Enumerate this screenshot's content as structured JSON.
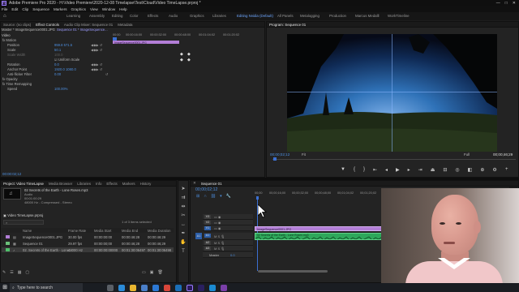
{
  "window": {
    "title": "Adobe Premiere Pro 2020 - H:\\Video Premiere\\2020-12-08 Timelapse\\Test\\Cloud\\Video TimeLapse.prproj *",
    "logo_text": "Pr",
    "controls": [
      "—",
      "□",
      "✕"
    ]
  },
  "menu": [
    "File",
    "Edit",
    "Clip",
    "Sequence",
    "Markers",
    "Graphics",
    "View",
    "Window",
    "Help"
  ],
  "workspaces": {
    "home_icon": "home-icon",
    "tabs": [
      "Learning",
      "Assembly",
      "Editing",
      "Color",
      "Effects",
      "Audio",
      "Graphics",
      "Libraries",
      "Editing Nvidia (Default)",
      "All Panels",
      "Metalogging",
      "Production",
      "Marcus Medalll",
      "WorkTimeline"
    ],
    "active": "Editing Nvidia (Default)"
  },
  "source_panel": {
    "tabs": [
      "Source: (no clips)",
      "Effect Controls",
      "Audio Clip Mixer: Sequence 01",
      "Metadata"
    ],
    "active_tab": "Effect Controls",
    "master_label": "Master * ImageSequence0001.JPG",
    "sequence_label": "Sequence 01 * ImageSequence...",
    "section_video": "Video",
    "clip_name": "ImageSequence0001.JPG",
    "rows": [
      {
        "label": "fx  Motion",
        "value": "",
        "indent": 0
      },
      {
        "label": "Position",
        "value": "959.8     571.5",
        "indent": 1
      },
      {
        "label": "Scale",
        "value": "50.1",
        "indent": 1
      },
      {
        "label": "Scale Width",
        "value": "100.0",
        "indent": 1
      },
      {
        "label": "",
        "value": "Uniform Scale",
        "indent": 2
      },
      {
        "label": "Rotation",
        "value": "0.0",
        "indent": 1
      },
      {
        "label": "Anchor Point",
        "value": "1920.0   1080.0",
        "indent": 1
      },
      {
        "label": "Anti-flicker Filter",
        "value": "0.00",
        "indent": 1
      },
      {
        "label": "fx  Opacity",
        "value": "",
        "indent": 0
      },
      {
        "label": "fx  Time Remapping",
        "value": "",
        "indent": 0
      },
      {
        "label": "Speed",
        "value": "100.00%",
        "indent": 1
      }
    ],
    "timecode": "00:00:02;12",
    "ruler": [
      "00:00",
      "00:00:16:00",
      "00:00:32:00",
      "00:00:48:00",
      "00:01:04:02",
      "00:01:20:02"
    ]
  },
  "program_monitor": {
    "title": "Program: Sequence 01",
    "timecode_left": "00;00;02;12",
    "fit": "Fit",
    "quality": "Full",
    "timecode_right": "00;00;46;29",
    "buttons": [
      "marker-icon",
      "in-point-icon",
      "out-point-icon",
      "go-to-in-icon",
      "step-back-icon",
      "play-icon",
      "step-forward-icon",
      "go-to-out-icon",
      "lift-icon",
      "extract-icon",
      "export-frame-icon",
      "comparison-icon",
      "vr-icon",
      "settings-icon"
    ],
    "colors": {
      "sky_top": "#0a0f1f",
      "sky_mid": "#1f5a93",
      "horizon": "#5c8fc8",
      "ground": "#1c2614"
    }
  },
  "project_panel": {
    "tabs": [
      "Project: Video TimeLapse",
      "Media Browser",
      "Libraries",
      "Info",
      "Effects",
      "Markers",
      "History"
    ],
    "active_tab": "Project: Video TimeLapse",
    "thumb_label": "Video TimeLapse.prproj",
    "clip_info_name": "02 Secrets of the Earth - Lone Rosen.mp3",
    "clip_info_line1": "Audio",
    "clip_info_line2": "00:01:00:29",
    "clip_info_line3": "48000 Hz - Compressed - Stereo",
    "project_file": "Video TimeLapse.prproj",
    "selection_info": "1 of 3 items selected",
    "columns": [
      "Name",
      "Frame Rate",
      "Media Start",
      "Media End",
      "Media Duration"
    ],
    "items": [
      {
        "name": "ImageSequence0001.JPG",
        "fps": "30.00 fps",
        "start": "00:00:00:00",
        "end": "00:00:46:28",
        "dur": "00:00:46:29",
        "color": "#b27ed6"
      },
      {
        "name": "Sequence 01",
        "fps": "29.97 fps",
        "start": "00:00:00;00",
        "end": "00:00:46;28",
        "dur": "00:00:46;29",
        "color": "#6bc07a"
      },
      {
        "name": "02. Secrets of the Earth - Lone...",
        "fps": "48000 Hz",
        "start": "00:00:00:00000",
        "end": "00:01:30:06497",
        "dur": "00:01:30:06498",
        "color": "#4fbf6a"
      }
    ]
  },
  "timeline": {
    "tab": "Sequence 01",
    "timecode": "00;00;02;12",
    "ruler": [
      "00;00",
      "00;00;16;00",
      "00;00;32;00",
      "00;00;48;00",
      "00;01;04;02",
      "00;01;20;02",
      "00;01;36;02",
      "00;01;52;02",
      "00;02;08;04",
      "00;02;24;04"
    ],
    "tracks": [
      {
        "name": "V3",
        "type": "video"
      },
      {
        "name": "V2",
        "type": "video"
      },
      {
        "name": "V1",
        "type": "video",
        "active": true
      },
      {
        "name": "A1",
        "type": "audio",
        "active": true
      },
      {
        "name": "A2",
        "type": "audio"
      },
      {
        "name": "A3",
        "type": "audio"
      }
    ],
    "master_label": "Master",
    "master_value": "0.0",
    "video_clip_label": "ImageSequence0001.JPG",
    "audio_clip_label": "02 Secrets of the Earth - Lone Rosen.mp3",
    "colors": {
      "video_clip": "#b27ed6",
      "audio_clip": "#2ea85b"
    }
  },
  "taskbar": {
    "search_placeholder": "Type here to search",
    "icons": [
      "task-view-icon",
      "edge-icon",
      "explorer-icon",
      "store-icon",
      "mail-icon",
      "chrome-icon",
      "photoshop-icon",
      "premiere-icon",
      "media-encoder-icon",
      "vscode-icon",
      "misc-icon"
    ]
  }
}
